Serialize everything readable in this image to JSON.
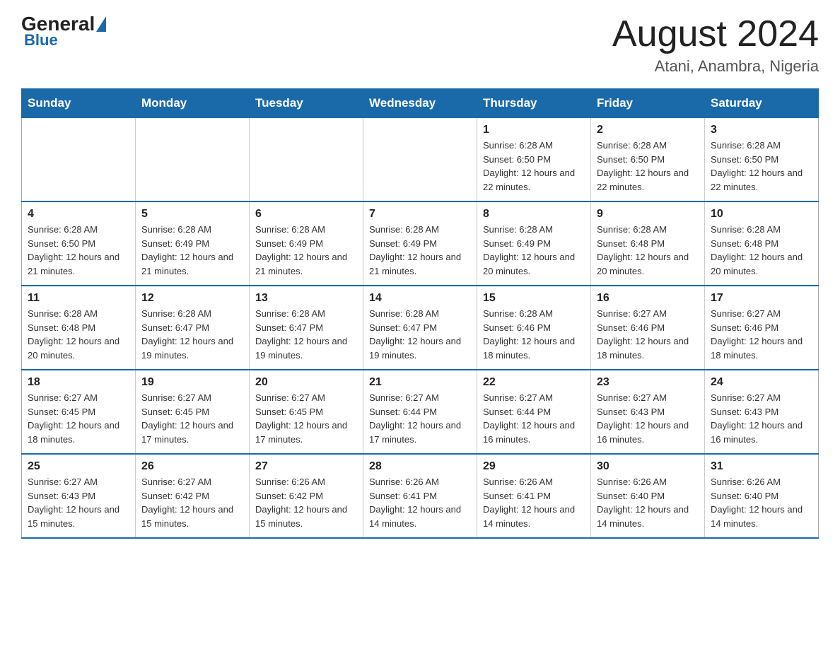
{
  "header": {
    "logo_general": "General",
    "logo_blue": "Blue",
    "month_title": "August 2024",
    "location": "Atani, Anambra, Nigeria"
  },
  "weekdays": [
    "Sunday",
    "Monday",
    "Tuesday",
    "Wednesday",
    "Thursday",
    "Friday",
    "Saturday"
  ],
  "weeks": [
    [
      {
        "day": "",
        "sunrise": "",
        "sunset": "",
        "daylight": ""
      },
      {
        "day": "",
        "sunrise": "",
        "sunset": "",
        "daylight": ""
      },
      {
        "day": "",
        "sunrise": "",
        "sunset": "",
        "daylight": ""
      },
      {
        "day": "",
        "sunrise": "",
        "sunset": "",
        "daylight": ""
      },
      {
        "day": "1",
        "sunrise": "Sunrise: 6:28 AM",
        "sunset": "Sunset: 6:50 PM",
        "daylight": "Daylight: 12 hours and 22 minutes."
      },
      {
        "day": "2",
        "sunrise": "Sunrise: 6:28 AM",
        "sunset": "Sunset: 6:50 PM",
        "daylight": "Daylight: 12 hours and 22 minutes."
      },
      {
        "day": "3",
        "sunrise": "Sunrise: 6:28 AM",
        "sunset": "Sunset: 6:50 PM",
        "daylight": "Daylight: 12 hours and 22 minutes."
      }
    ],
    [
      {
        "day": "4",
        "sunrise": "Sunrise: 6:28 AM",
        "sunset": "Sunset: 6:50 PM",
        "daylight": "Daylight: 12 hours and 21 minutes."
      },
      {
        "day": "5",
        "sunrise": "Sunrise: 6:28 AM",
        "sunset": "Sunset: 6:49 PM",
        "daylight": "Daylight: 12 hours and 21 minutes."
      },
      {
        "day": "6",
        "sunrise": "Sunrise: 6:28 AM",
        "sunset": "Sunset: 6:49 PM",
        "daylight": "Daylight: 12 hours and 21 minutes."
      },
      {
        "day": "7",
        "sunrise": "Sunrise: 6:28 AM",
        "sunset": "Sunset: 6:49 PM",
        "daylight": "Daylight: 12 hours and 21 minutes."
      },
      {
        "day": "8",
        "sunrise": "Sunrise: 6:28 AM",
        "sunset": "Sunset: 6:49 PM",
        "daylight": "Daylight: 12 hours and 20 minutes."
      },
      {
        "day": "9",
        "sunrise": "Sunrise: 6:28 AM",
        "sunset": "Sunset: 6:48 PM",
        "daylight": "Daylight: 12 hours and 20 minutes."
      },
      {
        "day": "10",
        "sunrise": "Sunrise: 6:28 AM",
        "sunset": "Sunset: 6:48 PM",
        "daylight": "Daylight: 12 hours and 20 minutes."
      }
    ],
    [
      {
        "day": "11",
        "sunrise": "Sunrise: 6:28 AM",
        "sunset": "Sunset: 6:48 PM",
        "daylight": "Daylight: 12 hours and 20 minutes."
      },
      {
        "day": "12",
        "sunrise": "Sunrise: 6:28 AM",
        "sunset": "Sunset: 6:47 PM",
        "daylight": "Daylight: 12 hours and 19 minutes."
      },
      {
        "day": "13",
        "sunrise": "Sunrise: 6:28 AM",
        "sunset": "Sunset: 6:47 PM",
        "daylight": "Daylight: 12 hours and 19 minutes."
      },
      {
        "day": "14",
        "sunrise": "Sunrise: 6:28 AM",
        "sunset": "Sunset: 6:47 PM",
        "daylight": "Daylight: 12 hours and 19 minutes."
      },
      {
        "day": "15",
        "sunrise": "Sunrise: 6:28 AM",
        "sunset": "Sunset: 6:46 PM",
        "daylight": "Daylight: 12 hours and 18 minutes."
      },
      {
        "day": "16",
        "sunrise": "Sunrise: 6:27 AM",
        "sunset": "Sunset: 6:46 PM",
        "daylight": "Daylight: 12 hours and 18 minutes."
      },
      {
        "day": "17",
        "sunrise": "Sunrise: 6:27 AM",
        "sunset": "Sunset: 6:46 PM",
        "daylight": "Daylight: 12 hours and 18 minutes."
      }
    ],
    [
      {
        "day": "18",
        "sunrise": "Sunrise: 6:27 AM",
        "sunset": "Sunset: 6:45 PM",
        "daylight": "Daylight: 12 hours and 18 minutes."
      },
      {
        "day": "19",
        "sunrise": "Sunrise: 6:27 AM",
        "sunset": "Sunset: 6:45 PM",
        "daylight": "Daylight: 12 hours and 17 minutes."
      },
      {
        "day": "20",
        "sunrise": "Sunrise: 6:27 AM",
        "sunset": "Sunset: 6:45 PM",
        "daylight": "Daylight: 12 hours and 17 minutes."
      },
      {
        "day": "21",
        "sunrise": "Sunrise: 6:27 AM",
        "sunset": "Sunset: 6:44 PM",
        "daylight": "Daylight: 12 hours and 17 minutes."
      },
      {
        "day": "22",
        "sunrise": "Sunrise: 6:27 AM",
        "sunset": "Sunset: 6:44 PM",
        "daylight": "Daylight: 12 hours and 16 minutes."
      },
      {
        "day": "23",
        "sunrise": "Sunrise: 6:27 AM",
        "sunset": "Sunset: 6:43 PM",
        "daylight": "Daylight: 12 hours and 16 minutes."
      },
      {
        "day": "24",
        "sunrise": "Sunrise: 6:27 AM",
        "sunset": "Sunset: 6:43 PM",
        "daylight": "Daylight: 12 hours and 16 minutes."
      }
    ],
    [
      {
        "day": "25",
        "sunrise": "Sunrise: 6:27 AM",
        "sunset": "Sunset: 6:43 PM",
        "daylight": "Daylight: 12 hours and 15 minutes."
      },
      {
        "day": "26",
        "sunrise": "Sunrise: 6:27 AM",
        "sunset": "Sunset: 6:42 PM",
        "daylight": "Daylight: 12 hours and 15 minutes."
      },
      {
        "day": "27",
        "sunrise": "Sunrise: 6:26 AM",
        "sunset": "Sunset: 6:42 PM",
        "daylight": "Daylight: 12 hours and 15 minutes."
      },
      {
        "day": "28",
        "sunrise": "Sunrise: 6:26 AM",
        "sunset": "Sunset: 6:41 PM",
        "daylight": "Daylight: 12 hours and 14 minutes."
      },
      {
        "day": "29",
        "sunrise": "Sunrise: 6:26 AM",
        "sunset": "Sunset: 6:41 PM",
        "daylight": "Daylight: 12 hours and 14 minutes."
      },
      {
        "day": "30",
        "sunrise": "Sunrise: 6:26 AM",
        "sunset": "Sunset: 6:40 PM",
        "daylight": "Daylight: 12 hours and 14 minutes."
      },
      {
        "day": "31",
        "sunrise": "Sunrise: 6:26 AM",
        "sunset": "Sunset: 6:40 PM",
        "daylight": "Daylight: 12 hours and 14 minutes."
      }
    ]
  ]
}
